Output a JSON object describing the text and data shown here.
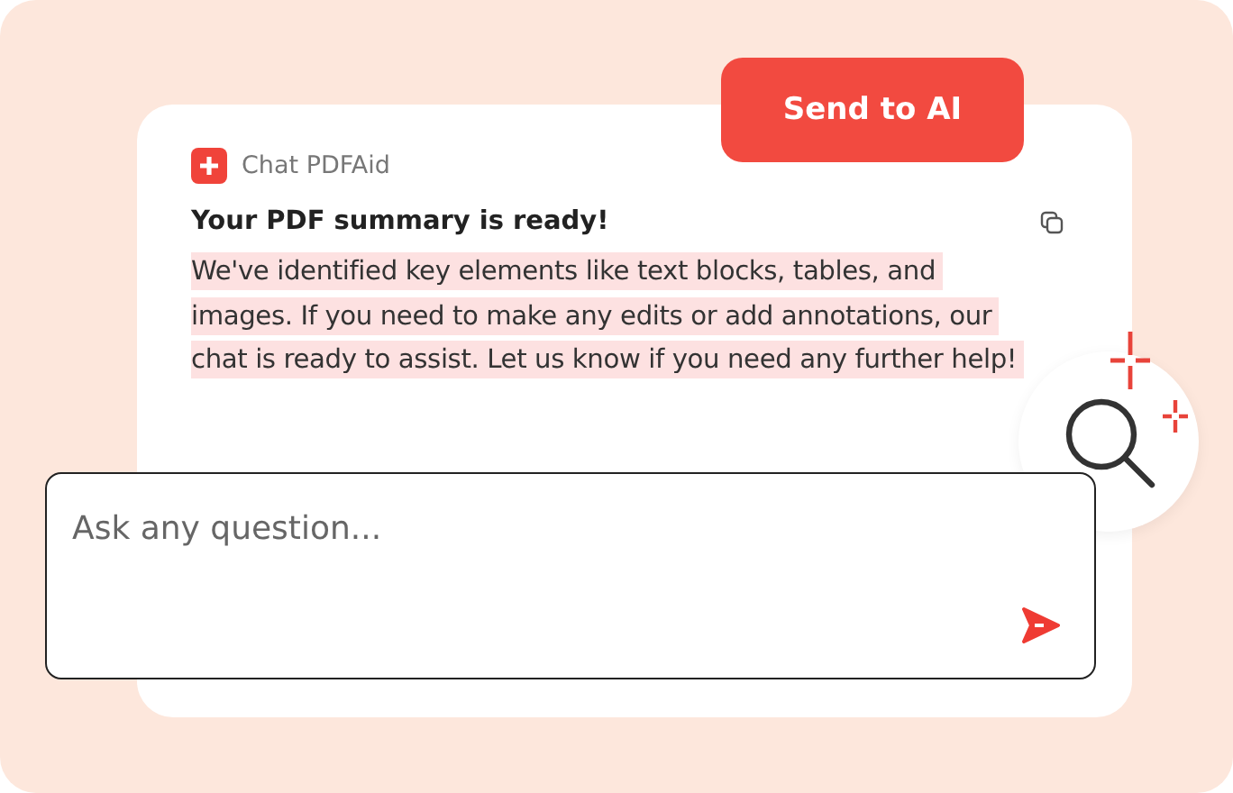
{
  "send_button": {
    "label": "Send to AI"
  },
  "app": {
    "name": "Chat PDFAid"
  },
  "message": {
    "title": "Your PDF summary is ready!",
    "body": "We've identified key elements like text blocks, tables, and images. If you need to make any edits or add annotations, our chat is ready to assist. Let us know if you need any further help!"
  },
  "question": {
    "placeholder": "Ask any question..."
  }
}
